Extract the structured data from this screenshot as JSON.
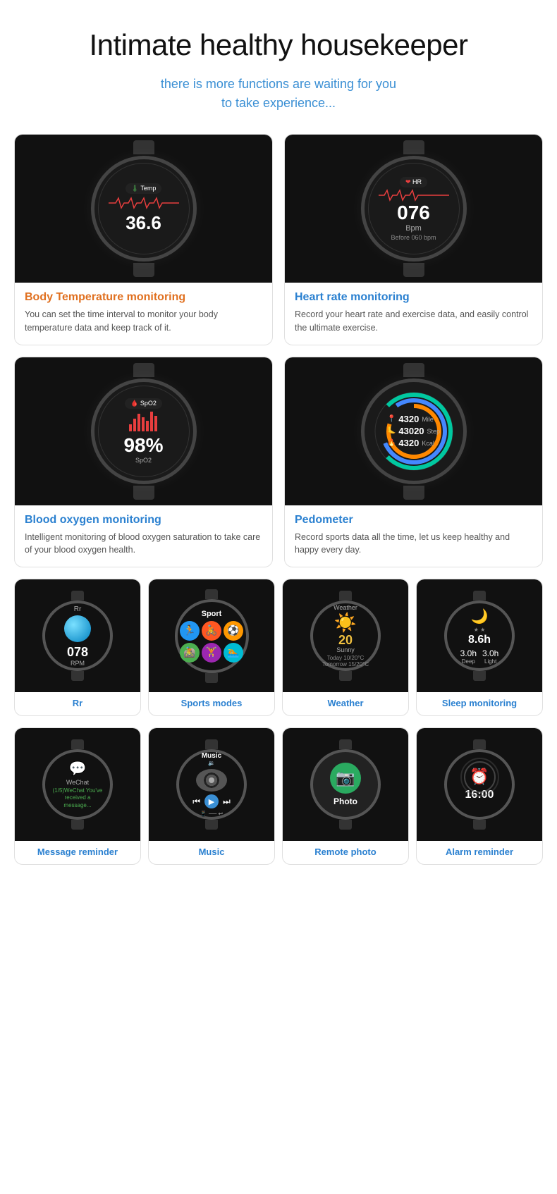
{
  "page": {
    "main_title": "Intimate healthy housekeeper",
    "subtitle_line1": "there is more functions are waiting for you",
    "subtitle_line2": "to take experience..."
  },
  "features": [
    {
      "id": "body-temp",
      "title": "Body Temperature monitoring",
      "title_color": "orange",
      "desc": "You can set the time interval to monitor your body temperature data and keep track of it.",
      "watch_type": "temp"
    },
    {
      "id": "heart-rate",
      "title": "Heart rate monitoring",
      "title_color": "blue",
      "desc": "Record your heart rate and exercise data, and easily control the ultimate exercise.",
      "watch_type": "hr"
    },
    {
      "id": "blood-oxygen",
      "title": "Blood oxygen monitoring",
      "title_color": "blue",
      "desc": "Intelligent monitoring of blood oxygen saturation to take care of your blood oxygen health.",
      "watch_type": "spo2"
    },
    {
      "id": "pedometer",
      "title": "Pedometer",
      "title_color": "blue",
      "desc": "Record sports data all the time, let us keep healthy and happy every day.",
      "watch_type": "step"
    }
  ],
  "small_features": [
    {
      "id": "rr",
      "label": "Rr",
      "watch_type": "rr"
    },
    {
      "id": "sports-modes",
      "label": "Sports modes",
      "watch_type": "sport"
    },
    {
      "id": "weather",
      "label": "Weather",
      "watch_type": "weather"
    },
    {
      "id": "sleep",
      "label": "Sleep monitoring",
      "watch_type": "sleep"
    }
  ],
  "small_features2": [
    {
      "id": "message",
      "label": "Message reminder",
      "watch_type": "message"
    },
    {
      "id": "music",
      "label": "Music",
      "watch_type": "music"
    },
    {
      "id": "photo",
      "label": "Remote photo",
      "watch_type": "photo"
    },
    {
      "id": "alarm",
      "label": "Alarm reminder",
      "watch_type": "alarm"
    }
  ],
  "watch_data": {
    "temp": {
      "value": "36.6",
      "label": "Temp"
    },
    "hr": {
      "value": "076",
      "unit": "Bpm",
      "before": "Before 060 bpm"
    },
    "spo2": {
      "value": "98%",
      "label": "SpO2"
    },
    "step": {
      "mile": "4320",
      "mile_label": "Mile",
      "step": "43020",
      "step_label": "Step",
      "kcal": "4320",
      "kcal_label": "Kcal"
    },
    "rr": {
      "value": "078",
      "unit": "RPM"
    },
    "sport": {
      "title": "Sport"
    },
    "weather": {
      "temp": "20",
      "condition": "Sunny",
      "today": "Today 10/20°C",
      "tomorrow": "Tomorrow 15/20°C"
    },
    "sleep": {
      "total": "8.6h",
      "deep": "3.0h",
      "deep_label": "Deep",
      "light": "3.0h",
      "light_label": "Light"
    },
    "music": {
      "title": "Music"
    },
    "photo": {
      "label": "Photo"
    },
    "alarm": {
      "time": "16:00"
    }
  }
}
